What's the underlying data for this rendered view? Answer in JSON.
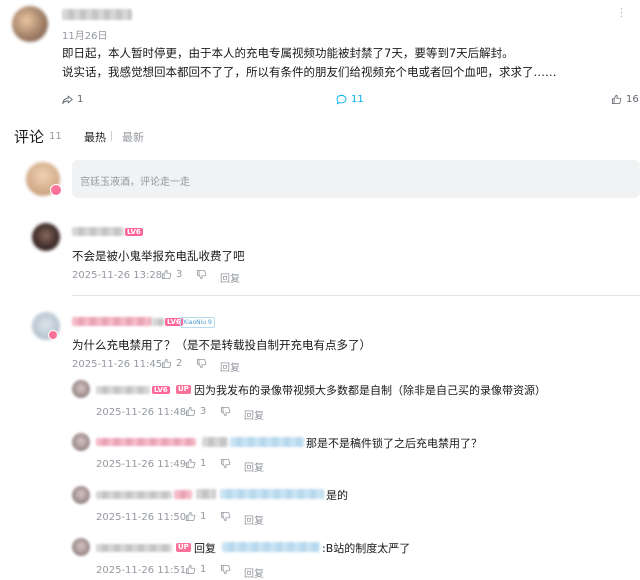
{
  "post": {
    "date": "11月26日",
    "line1": "即日起，本人暂时停更，由于本人的充电专属视频功能被封禁了7天，要等到7天后解封。",
    "line2": "说实话，我感觉想回本都回不了了，所以有条件的朋友们给视频充个电或者回个血吧，求求了……",
    "forward_count": "1",
    "comment_count": "11",
    "like_count": "16"
  },
  "comments_header": {
    "title": "评论",
    "count": "11",
    "sort_hot": "最热",
    "sort_new": "最新"
  },
  "input": {
    "placeholder": "宫廷玉液酒，评论走一走"
  },
  "comments": [
    {
      "level": "6",
      "text": "不会是被小鬼举报充电乱收费了吧",
      "time": "2025-11-26 13:28",
      "likes": "3",
      "reply": "回复"
    },
    {
      "level": "6",
      "badge": "XiaoNiu 9",
      "text": "为什么充电禁用了？（是不是转载投自制开充电有点多了）",
      "time": "2025-11-26 11:45",
      "likes": "2",
      "reply": "回复",
      "replies": [
        {
          "level": "LV6",
          "up": "UP",
          "text": "因为我发布的录像带视频大多数都是自制（除非是自己买的录像带资源）",
          "time": "2025-11-26 11:48",
          "likes": "3",
          "reply": "回复"
        },
        {
          "text": "那是不是稿件锁了之后充电禁用了？",
          "time": "2025-11-26 11:49",
          "likes": "1",
          "reply": "回复"
        },
        {
          "text": "是的",
          "time": "2025-11-26 11:50",
          "likes": "1",
          "reply": "回复"
        },
        {
          "up": "UP",
          "prefix": "回复",
          "text": ":B站的制度太严了",
          "time": "2025-11-26 11:51",
          "likes": "1",
          "reply": "回复"
        }
      ]
    }
  ],
  "colors": {
    "accent": "#00aeec",
    "pink": "#fb7299",
    "text": "#18191c",
    "muted": "#9499a0"
  }
}
